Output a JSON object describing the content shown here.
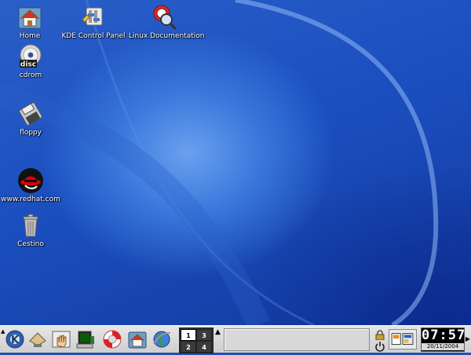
{
  "desktop": {
    "icons": [
      {
        "label": "Home",
        "icon": "home-folder-icon"
      },
      {
        "label": "KDE Control Panel",
        "icon": "control-panel-icon"
      },
      {
        "label": "Linux Documentation",
        "icon": "documentation-icon"
      },
      {
        "label": "cdrom",
        "icon": "cdrom-disc-icon",
        "badge": "disc"
      },
      {
        "label": "floppy",
        "icon": "floppy-icon"
      },
      {
        "label": "www.redhat.com",
        "icon": "redhat-logo-icon"
      },
      {
        "label": "Cestino",
        "icon": "trash-icon"
      }
    ]
  },
  "panel": {
    "launchers": [
      {
        "icon": "kde-k-menu-icon"
      },
      {
        "icon": "show-desktop-icon"
      },
      {
        "icon": "hand-help-icon"
      },
      {
        "icon": "terminal-icon"
      },
      {
        "icon": "lifebuoy-help-icon"
      },
      {
        "icon": "home-launcher-icon"
      },
      {
        "icon": "web-browser-icon"
      }
    ],
    "pager": {
      "desktops": [
        "1",
        "3",
        "2",
        "4"
      ],
      "active": "1"
    },
    "tray": {
      "lock": "lock-icon",
      "power": "power-icon"
    },
    "clock": {
      "time": "07:57",
      "date": "20/11/2004"
    }
  },
  "colors": {
    "desktop_bg": "#1f4fb3",
    "panel_bg": "#dcdcdc"
  }
}
